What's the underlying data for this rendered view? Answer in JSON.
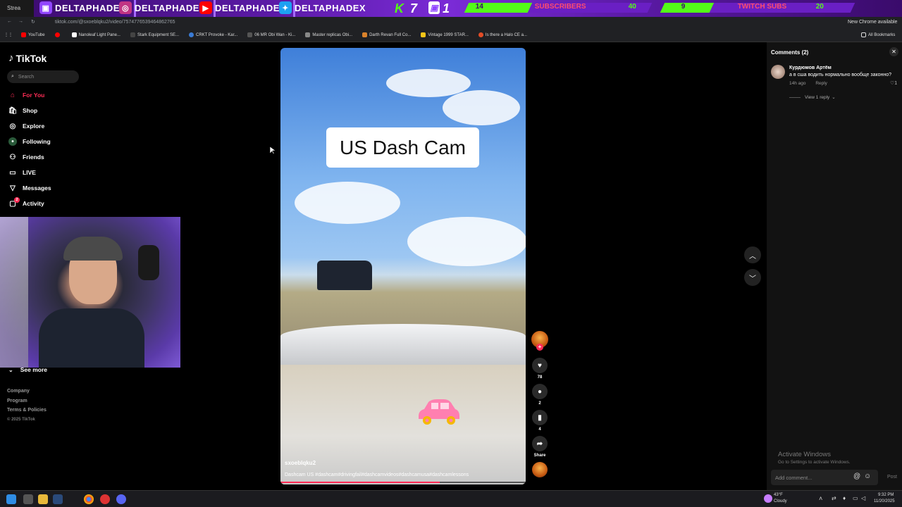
{
  "overlay": {
    "stream_tab": "Strea",
    "socials": [
      "DELTAPHADE",
      "DELTAPHADE",
      "DELTAPHADE",
      "DELTAPHADEX"
    ],
    "kick_count": "7",
    "twitch_count": "1",
    "subscribers": {
      "current": "14",
      "label": "SUBSCRIBERS",
      "goal": "40"
    },
    "twitch_subs": {
      "current": "9",
      "label": "TWITCH SUBS",
      "goal": "20"
    },
    "colors": {
      "twitch": "#9146ff",
      "instagram": "#c13584",
      "youtube": "#ff0000",
      "twitter": "#1da1f2",
      "kick": "#53fc18"
    }
  },
  "browser": {
    "url": "tiktok.com/@sxoeblqku2/video/7574776539464862765",
    "update_notice": "New Chrome available",
    "all_bookmarks": "All Bookmarks",
    "bookmarks": [
      {
        "label": "YouTube",
        "color": "#ff0000"
      },
      {
        "label": "",
        "color": "#ff0000"
      },
      {
        "label": "Nanoleaf Light Pane...",
        "color": "#ffffff"
      },
      {
        "label": "Stark Equipment SE...",
        "color": "#444444"
      },
      {
        "label": "CRKT Provoke - Kar...",
        "color": "#3a7bd5"
      },
      {
        "label": "06 MR Obi Wan - Ki...",
        "color": "#555555"
      },
      {
        "label": "Master replicas Obi...",
        "color": "#888888"
      },
      {
        "label": "Darth Revan Full Co...",
        "color": "#d9822b"
      },
      {
        "label": "Vintage 1999 STAR...",
        "color": "#f5c518"
      },
      {
        "label": "Is there a Halo CE a...",
        "color": "#e34c26"
      }
    ]
  },
  "sidebar": {
    "brand": "TikTok",
    "search_placeholder": "Search",
    "items": [
      {
        "label": "For You",
        "icon": "home-icon",
        "active": true
      },
      {
        "label": "Shop",
        "icon": "shop-icon"
      },
      {
        "label": "Explore",
        "icon": "compass-icon"
      },
      {
        "label": "Following",
        "icon": "following-icon"
      },
      {
        "label": "Friends",
        "icon": "friends-icon"
      },
      {
        "label": "LIVE",
        "icon": "live-icon"
      },
      {
        "label": "Messages",
        "icon": "messages-icon"
      },
      {
        "label": "Activity",
        "icon": "activity-icon",
        "badge": "2"
      }
    ],
    "see_more": "See more",
    "footer": [
      "Company",
      "Program",
      "Terms & Policies",
      "© 2025 TikTok"
    ],
    "accent": "#fe2c55"
  },
  "video": {
    "caption": "US Dash Cam",
    "author": "sxoeblqku2",
    "description": "Dashcam US #dashcam#drivingfail#dashcamvideos#dashcamusa#dashcamlessons",
    "progress": 0.65
  },
  "actions": {
    "likes": "78",
    "comments": "2",
    "saves": "4",
    "share_label": "Share"
  },
  "comments_panel": {
    "title": "Comments (2)",
    "comment": {
      "user": "Курдюмов Артём",
      "text": "а в сша водить нормально вообще законно?",
      "time": "14h ago",
      "reply_label": "Reply",
      "likes": "1",
      "view_replies": "View 1 reply"
    },
    "watermark_line1": "Activate Windows",
    "watermark_line2": "Go to Settings to activate Windows.",
    "add_comment_placeholder": "Add comment...",
    "post_label": "Post"
  },
  "taskbar": {
    "weather_temp": "43°F",
    "weather_desc": "Cloudy",
    "time": "9:32 PM",
    "date": "11/20/2025"
  }
}
